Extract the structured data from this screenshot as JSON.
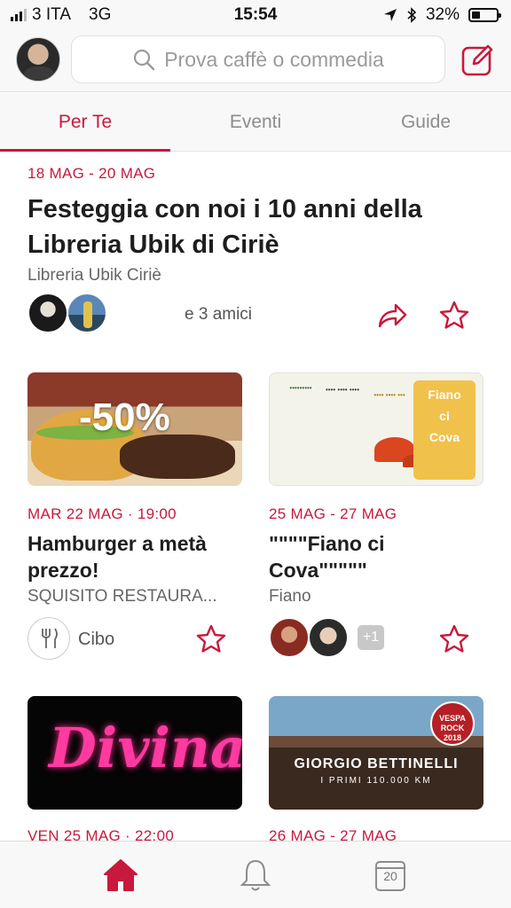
{
  "status": {
    "carrier": "3 ITA",
    "network": "3G",
    "time": "15:54",
    "battery": "32%"
  },
  "header": {
    "search_placeholder": "Prova caffè o commedia"
  },
  "tabs": [
    {
      "label": "Per Te",
      "active": true
    },
    {
      "label": "Eventi",
      "active": false
    },
    {
      "label": "Guide",
      "active": false
    }
  ],
  "featured": {
    "date": "18 MAG - 20 MAG",
    "title": "Festeggia con noi i 10 anni della Libreria Ubik di Ciriè",
    "venue": "Libreria Ubik Ciriè",
    "friends_text": "e 3 amici"
  },
  "cards": [
    {
      "image_text": "-50%",
      "date": "MAR 22 MAG · 19:00",
      "title": "Hamburger a metà prezzo!",
      "venue": "SQUISITO RESTAURA...",
      "category": "Cibo"
    },
    {
      "image_text": [
        "Fiano",
        "ci",
        "Cova"
      ],
      "date": "25 MAG - 27 MAG",
      "title": "\"\"\"\"Fiano ci Cova\"\"\"\"\"",
      "venue": "Fiano",
      "more_count": "+1"
    },
    {
      "image_text": "Divina",
      "date": "VEN 25 MAG · 22:00"
    },
    {
      "image_text": [
        "GIORGIO BETTINELLI",
        "I PRIMI 110.000 KM",
        "VESPA ROCK 2018"
      ],
      "date": "26 MAG - 27 MAG"
    }
  ],
  "bottom_nav": {
    "calendar_day": "20"
  },
  "colors": {
    "accent": "#c8193c",
    "muted": "#8c8c8c"
  },
  "icons": [
    "search-icon",
    "compose-icon",
    "share-icon",
    "star-icon",
    "cutlery-icon",
    "home-icon",
    "bell-icon",
    "calendar-icon",
    "location-arrow-icon",
    "bluetooth-icon"
  ]
}
